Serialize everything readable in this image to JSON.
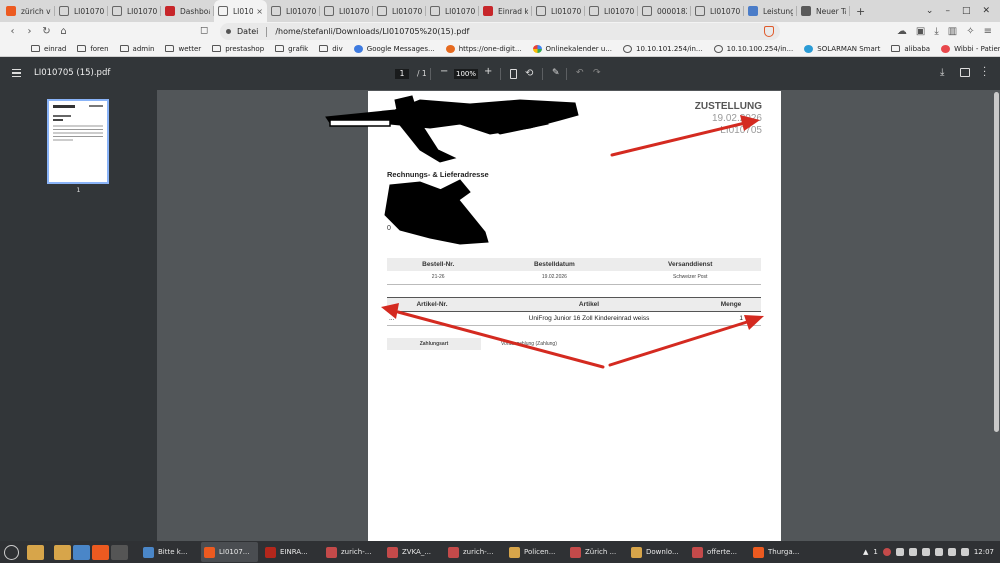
{
  "browser": {
    "tabs": [
      {
        "label": "zürich ve",
        "icon": "brave-icon",
        "active": false
      },
      {
        "label": "LI010705",
        "icon": "globe-icon",
        "active": false
      },
      {
        "label": "LI010705",
        "icon": "globe-icon",
        "active": false
      },
      {
        "label": "Dashboa",
        "icon": "red-square-icon",
        "active": false
      },
      {
        "label": "LI010",
        "icon": "globe-icon",
        "active": true
      },
      {
        "label": "LI010705",
        "icon": "globe-icon",
        "active": false
      },
      {
        "label": "LI010705",
        "icon": "globe-icon",
        "active": false
      },
      {
        "label": "LI010705",
        "icon": "globe-icon",
        "active": false
      },
      {
        "label": "LI010705",
        "icon": "globe-icon",
        "active": false
      },
      {
        "label": "Einrad k",
        "icon": "red-square-icon",
        "active": false
      },
      {
        "label": "LI010705",
        "icon": "globe-icon",
        "active": false
      },
      {
        "label": "LI010705",
        "icon": "globe-icon",
        "active": false
      },
      {
        "label": "0000182",
        "icon": "globe-icon",
        "active": false
      },
      {
        "label": "LI010705",
        "icon": "globe-icon",
        "active": false
      },
      {
        "label": "Leistung",
        "icon": "stack-icon",
        "active": false
      },
      {
        "label": "Neuer Ta",
        "icon": "brave-shield-icon",
        "active": false
      }
    ],
    "new_tab": "+",
    "url_label": "Datei",
    "url": "/home/stefanli/Downloads/LI010705%20(15).pdf"
  },
  "bookmarks": [
    {
      "label": "einrad",
      "icon": "folder"
    },
    {
      "label": "foren",
      "icon": "folder"
    },
    {
      "label": "admin",
      "icon": "folder"
    },
    {
      "label": "wetter",
      "icon": "folder"
    },
    {
      "label": "prestashop",
      "icon": "folder"
    },
    {
      "label": "grafik",
      "icon": "folder"
    },
    {
      "label": "div",
      "icon": "folder"
    },
    {
      "label": "Google Messages...",
      "icon": "blue"
    },
    {
      "label": "https://one-digit...",
      "icon": "orange"
    },
    {
      "label": "Onlinekalender u...",
      "icon": "gg"
    },
    {
      "label": "10.10.101.254/in...",
      "icon": "globe"
    },
    {
      "label": "10.10.100.254/in...",
      "icon": "globe"
    },
    {
      "label": "SOLARMAN Smart",
      "icon": "solar"
    },
    {
      "label": "alibaba",
      "icon": "folder"
    },
    {
      "label": "Wibbi - Patient P...",
      "icon": "wibbi"
    }
  ],
  "pdf_viewer": {
    "title": "LI010705 (15).pdf",
    "page_current": "1",
    "page_total": "/ 1",
    "zoom": "100%",
    "thumbnail_page": "1"
  },
  "document": {
    "heading": "ZUSTELLUNG",
    "date": "19.02.2026",
    "doc_number": "LI010705",
    "address_heading": "Rechnungs- & Lieferadresse",
    "address_fragment_1": "te R",
    "address_fragment_2": "weiz",
    "address_fragment_3": "0",
    "order_table": {
      "headers": [
        "Bestell-Nr.",
        "Bestelldatum",
        "Versanddienst"
      ],
      "row": [
        "21-26",
        "19.02.2026",
        "Schweizer Post"
      ]
    },
    "item_table": {
      "headers": [
        "Artikel-Nr.",
        "Artikel",
        "Menge"
      ],
      "row": [
        "...",
        "UniFrog Junior 16 Zoll Kindereinrad weiss",
        "1"
      ]
    },
    "payment": {
      "label": "Zahlungsart",
      "value": "Vorauszahlung (Zahlung)"
    }
  },
  "annotations": {
    "arrow_color": "#d42a20",
    "redaction_color": "#000000"
  },
  "taskbar": {
    "tasks": [
      {
        "label": "Bitte k...",
        "icon": "mail-icon",
        "color": "#4a86c8"
      },
      {
        "label": "LI0107...",
        "icon": "brave-icon",
        "color": "#ec5a20",
        "active": true
      },
      {
        "label": "EINRA...",
        "icon": "filezilla-icon",
        "color": "#b4271c"
      },
      {
        "label": "zurich-...",
        "icon": "viewer-icon",
        "color": "#c44a4a"
      },
      {
        "label": "ZVKA_...",
        "icon": "viewer-icon",
        "color": "#c44a4a"
      },
      {
        "label": "zurich-...",
        "icon": "viewer-icon",
        "color": "#c44a4a"
      },
      {
        "label": "Policen...",
        "icon": "folder-icon",
        "color": "#d7a54a"
      },
      {
        "label": "Zürich ...",
        "icon": "viewer-icon",
        "color": "#c44a4a"
      },
      {
        "label": "Downlo...",
        "icon": "folder-icon",
        "color": "#d7a54a"
      },
      {
        "label": "offerte...",
        "icon": "viewer-icon",
        "color": "#c44a4a"
      },
      {
        "label": "Thurga...",
        "icon": "brave-icon",
        "color": "#ec5a20"
      }
    ],
    "workspace": "1",
    "time": "12:07"
  }
}
